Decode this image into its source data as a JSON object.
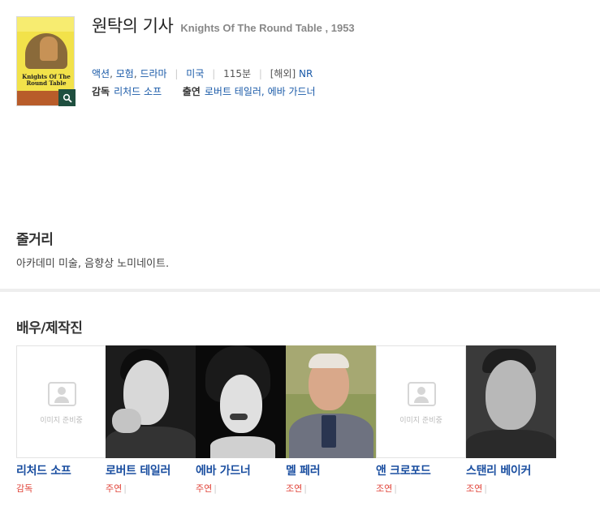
{
  "movie": {
    "title_ko": "원탁의 기사",
    "title_en": "Knights Of The Round Table , 1953",
    "poster_title": "Knights Of The Round Table",
    "genres": [
      "액션",
      "모험",
      "드라마"
    ],
    "country": "미국",
    "runtime": "115분",
    "rating_prefix": "[해외]",
    "rating": "NR",
    "director_label": "감독",
    "director": "리처드 소프",
    "cast_label": "출연",
    "cast_names": [
      "로버트 테일러",
      "에바 가드너"
    ]
  },
  "synopsis": {
    "heading": "줄거리",
    "text": "아카데미 미술, 음향상 노미네이트."
  },
  "crew": {
    "heading": "배우/제작진",
    "no_image_text": "이미지 준비중",
    "members": [
      {
        "name": "리처드 소프",
        "role": "감독",
        "has_photo": false
      },
      {
        "name": "로버트 테일러",
        "role": "주연",
        "has_photo": true
      },
      {
        "name": "에바 가드너",
        "role": "주연",
        "has_photo": true
      },
      {
        "name": "멜 페러",
        "role": "조연",
        "has_photo": true
      },
      {
        "name": "앤 크로포드",
        "role": "조연",
        "has_photo": false
      },
      {
        "name": "스탠리 베이커",
        "role": "조연",
        "has_photo": true
      }
    ]
  },
  "colors": {
    "link": "#1a5aa8",
    "role": "#e0453b",
    "zoom_button": "#1f4f3f"
  }
}
